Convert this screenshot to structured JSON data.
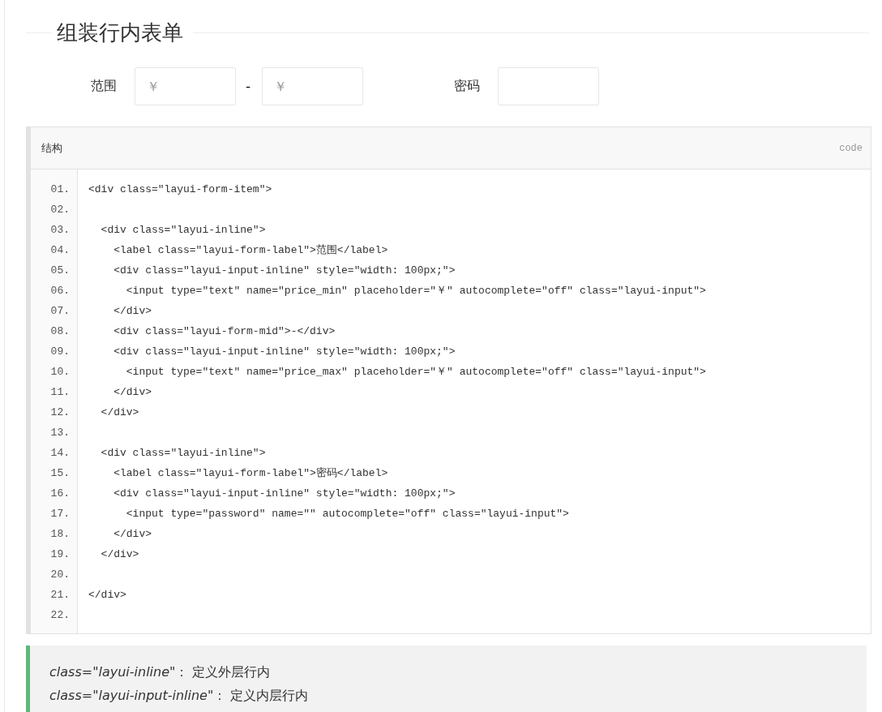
{
  "section_title": "组装行内表单",
  "form": {
    "items": [
      {
        "label": "范围",
        "fields": [
          {
            "kind": "text",
            "placeholder": "￥"
          },
          {
            "kind": "text",
            "placeholder": "￥"
          }
        ],
        "separator": "-"
      },
      {
        "label": "密码",
        "fields": [
          {
            "kind": "password"
          }
        ]
      }
    ]
  },
  "code_block": {
    "title": "结构",
    "tag": "code",
    "lines": [
      {
        "number": "01.",
        "text": "<div class=\"layui-form-item\">"
      },
      {
        "number": "02."
      },
      {
        "number": "03.",
        "text": "  <div class=\"layui-inline\">"
      },
      {
        "number": "04.",
        "text": "    <label class=\"layui-form-label\">范围</label>"
      },
      {
        "number": "05.",
        "text": "    <div class=\"layui-input-inline\" style=\"width: 100px;\">"
      },
      {
        "number": "06.",
        "text": "      <input type=\"text\" name=\"price_min\" placeholder=\"￥\" autocomplete=\"off\" class=\"layui-input\">"
      },
      {
        "number": "07.",
        "text": "    </div>"
      },
      {
        "number": "08.",
        "text": "    <div class=\"layui-form-mid\">-</div>"
      },
      {
        "number": "09.",
        "text": "    <div class=\"layui-input-inline\" style=\"width: 100px;\">"
      },
      {
        "number": "10.",
        "text": "      <input type=\"text\" name=\"price_max\" placeholder=\"￥\" autocomplete=\"off\" class=\"layui-input\">"
      },
      {
        "number": "11.",
        "text": "    </div>"
      },
      {
        "number": "12.",
        "text": "  </div>"
      },
      {
        "number": "13."
      },
      {
        "number": "14.",
        "text": "  <div class=\"layui-inline\">"
      },
      {
        "number": "15.",
        "text": "    <label class=\"layui-form-label\">密码</label>"
      },
      {
        "number": "16.",
        "text": "    <div class=\"layui-input-inline\" style=\"width: 100px;\">"
      },
      {
        "number": "17.",
        "text": "      <input type=\"password\" name=\"\" autocomplete=\"off\" class=\"layui-input\">"
      },
      {
        "number": "18.",
        "text": "    </div>"
      },
      {
        "number": "19.",
        "text": "  </div>"
      },
      {
        "number": "20."
      },
      {
        "number": "21.",
        "text": "</div>"
      },
      {
        "number": "22."
      }
    ]
  },
  "note": [
    "*class=\"layui-inline\"*： 定义外层行内",
    "*class=\"layui-input-inline\"*： 定义内层行内"
  ]
}
